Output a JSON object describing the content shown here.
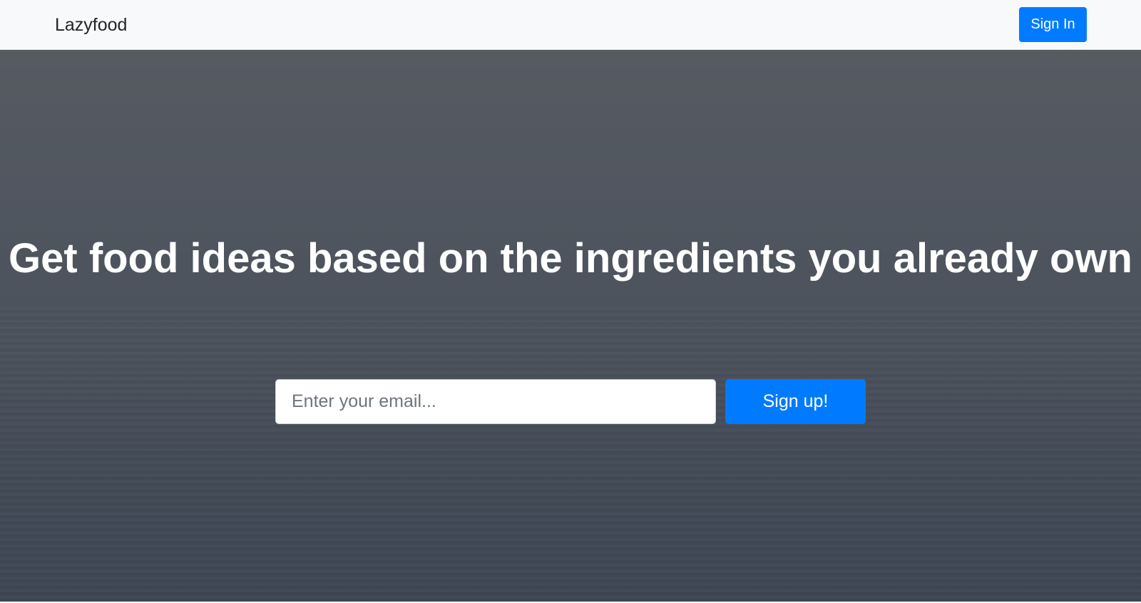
{
  "navbar": {
    "brand": "Lazyfood",
    "signin_label": "Sign In"
  },
  "hero": {
    "headline": "Get food ideas based on the ingredients you already own",
    "email_placeholder": "Enter your email...",
    "signup_label": "Sign up!"
  },
  "colors": {
    "primary": "#007bff",
    "navbar_bg": "#f8f9fa",
    "hero_bg_top": "#565b62",
    "hero_bg_bottom": "#3d4653"
  }
}
